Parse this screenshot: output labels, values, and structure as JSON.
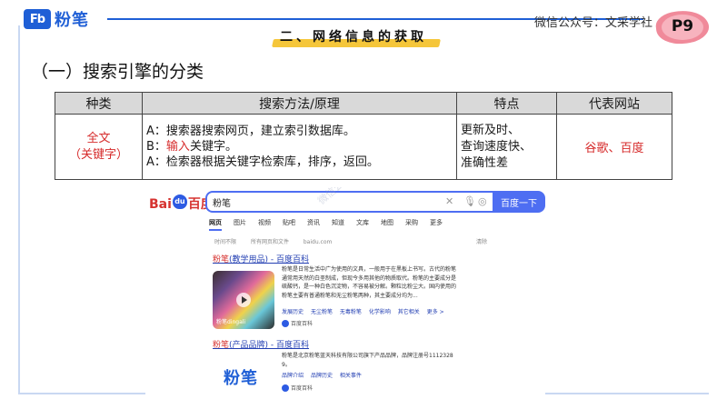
{
  "header": {
    "logo_mark": "Fb",
    "logo_text": "粉笔",
    "section_title": "二、网络信息的获取",
    "wechat": "微信公众号：文采学社",
    "page_number": "P9"
  },
  "heading": "（一）搜索引擎的分类",
  "table": {
    "headers": [
      "种类",
      "搜索方法/原理",
      "特点",
      "代表网站"
    ],
    "type_line1": "全文",
    "type_line2": "（关键字）",
    "method_a": "A：搜索器搜索网页，建立索引数据库。",
    "method_b_prefix": "B：",
    "method_b_red": "输入",
    "method_b_rest": "关键字。",
    "method_c": "A：检索器根据关键字检索库，排序，返回。",
    "feature_1": "更新及时、",
    "feature_2": "查询速度快、",
    "feature_3": "准确性差",
    "sites": "谷歌、百度"
  },
  "search_shot": {
    "logo_bai": "Bai",
    "logo_paw": "du",
    "logo_du": "百度",
    "query": "粉笔",
    "button": "百度一下",
    "tabs": [
      "网页",
      "图片",
      "视频",
      "贴吧",
      "资讯",
      "知道",
      "文库",
      "地图",
      "采购",
      "更多"
    ],
    "filter_time": "时间不限",
    "filter_site": "所有网页和文件",
    "filter_domain": "baidu.com",
    "filter_clear": "清除",
    "result1_kw": "粉笔",
    "result1_title": "(教学用品) - 百度百科",
    "result1_body_1": "粉笔是日常生活中广为使用的文具，一般用于在黑板上书写。古代的粉笔",
    "result1_body_2": "通常用天然的白垩制成，但现今多用其他的物质取代。粉笔的主要成分是",
    "result1_body_3": "硫酸钙，是一种白色沉淀物，不容易被分解。颗粒比粉尘大。国内使用的",
    "result1_body_4": "粉笔主要有普通粉笔和无尘粉笔两种，其主要成分均为...",
    "result1_links": [
      "发展历史",
      "无尘粉笔",
      "无毒粉笔",
      "化学影响",
      "其它相关",
      "更多 >"
    ],
    "result1_thumb_caption": "粉笔dingali",
    "result_source": "百度百科",
    "result2_kw": "粉笔",
    "result2_title": "(产品品牌) - 百度百科",
    "result2_body_1": "粉笔是北京粉笔蓝天科技有限公司旗下产品品牌，品牌注册号1112328",
    "result2_body_2": "9。",
    "result2_links": [
      "品牌介绍",
      "品牌历史",
      "相关事件"
    ],
    "brand_logo": "粉笔",
    "watermark": "微信公众号：文采学社"
  }
}
